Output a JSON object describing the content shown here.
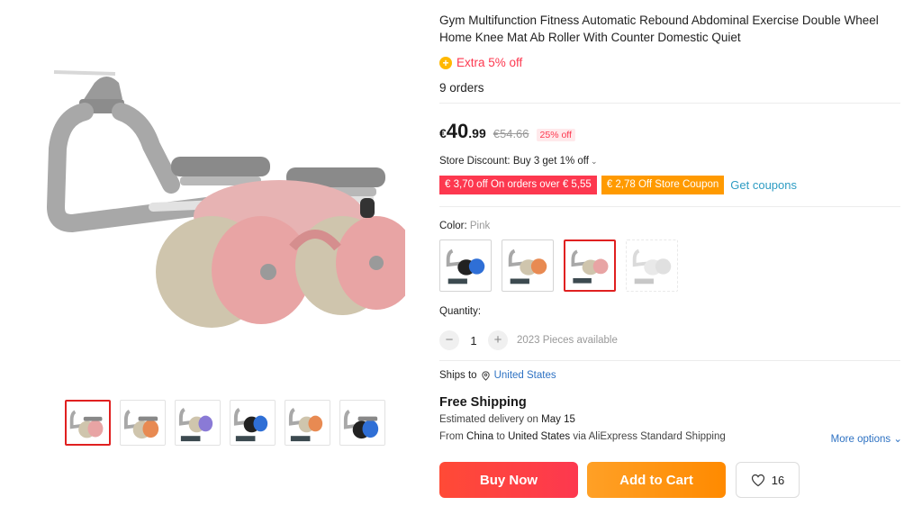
{
  "product": {
    "title": "Gym Multifunction Fitness Automatic Rebound Abdominal Exercise Double Wheel Home Knee Mat Ab Roller With Counter Domestic Quiet",
    "extra_discount": "Extra 5% off",
    "orders": "9 orders"
  },
  "price": {
    "currency": "€",
    "integer": "40",
    "decimal": ".99",
    "original": "€54.66",
    "discount_badge": "25% off"
  },
  "store_discount": {
    "label": "Store Discount: Buy 3 get 1% off",
    "coupon_red": "€ 3,70 off On orders over € 5,55",
    "coupon_orange": "€ 2,78 Off Store Coupon",
    "get_coupons": "Get coupons"
  },
  "color": {
    "label": "Color:",
    "selected": "Pink",
    "options": [
      {
        "name": "blue",
        "wheel": "#2f6fd6"
      },
      {
        "name": "orange",
        "wheel": "#e88a52"
      },
      {
        "name": "pink",
        "wheel": "#e8a4a4"
      },
      {
        "name": "grey",
        "wheel": "#c8c8c8"
      }
    ]
  },
  "quantity": {
    "label": "Quantity:",
    "value": "1",
    "minus": "−",
    "plus": "+",
    "available": "2023 Pieces available"
  },
  "shipping": {
    "ships_to_label": "Ships to",
    "location": "United States",
    "free_shipping": "Free Shipping",
    "estimated_prefix": "Estimated delivery on",
    "estimated_date": "May 15",
    "from_prefix": "From",
    "from_country": "China",
    "to_word": "to",
    "to_country": "United States",
    "via": "via AliExpress Standard Shipping",
    "more_options": "More options"
  },
  "actions": {
    "buy_now": "Buy Now",
    "add_to_cart": "Add to Cart",
    "wishlist_count": "16"
  },
  "gallery": {
    "thumbs": [
      {
        "wheel": "#e8a4a4"
      },
      {
        "wheel": "#e88a52"
      },
      {
        "wheel": "#8a7ad6"
      },
      {
        "wheel": "#2f6fd6"
      },
      {
        "wheel": "#e88a52"
      },
      {
        "wheel": "#2f6fd6"
      }
    ]
  },
  "colors": {
    "accent_red": "#fd384f",
    "accent_orange": "#ff9a00",
    "link_blue": "#2e72c3"
  }
}
